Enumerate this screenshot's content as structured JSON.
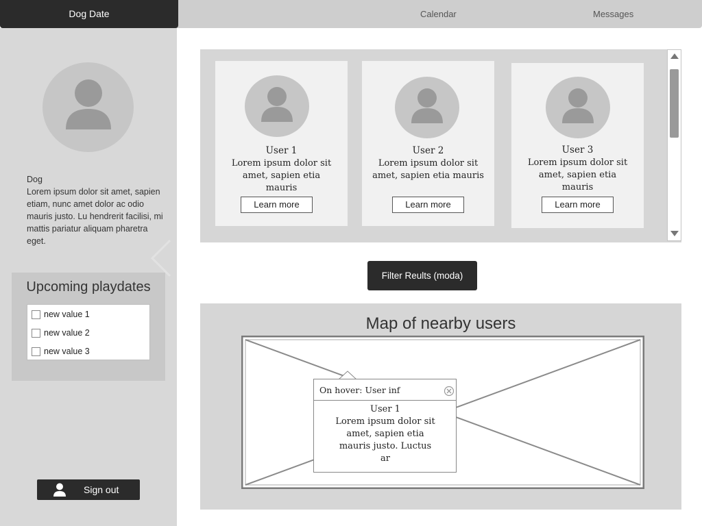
{
  "header": {
    "brand": "Dog Date",
    "nav": [
      "Calendar",
      "Messages"
    ]
  },
  "sidebar": {
    "profile_name": "Dog",
    "profile_description": "Lorem ipsum dolor sit amet, sapien etiam, nunc amet dolor ac odio mauris justo. Lu hendrerit facilisi, mi mattis pariatur aliquam pharetra eget.",
    "playdates_title": "Upcoming playdates",
    "playdates": [
      "new value 1",
      "new value 2",
      "new value 3"
    ],
    "signout_label": "Sign out"
  },
  "users": [
    {
      "name": "User 1",
      "desc": "Lorem ipsum dolor sit amet, sapien etia mauris",
      "button": "Learn more"
    },
    {
      "name": "User 2",
      "desc": "Lorem ipsum dolor sit amet, sapien etia mauris",
      "button": "Learn more"
    },
    {
      "name": "User 3",
      "desc": "Lorem ipsum dolor sit amet, sapien etia mauris",
      "button": "Learn more"
    }
  ],
  "filter_button": "Filter Reults (moda)",
  "map": {
    "title": "Map of nearby users",
    "tooltip": {
      "title": "On hover: User inf",
      "name": "User 1",
      "body": "Lorem ipsum dolor sit amet, sapien etia mauris justo. Luctus ar"
    }
  },
  "icons": {
    "avatar": "user-silhouette-icon",
    "close": "close-circle-icon",
    "signout": "user-icon"
  }
}
